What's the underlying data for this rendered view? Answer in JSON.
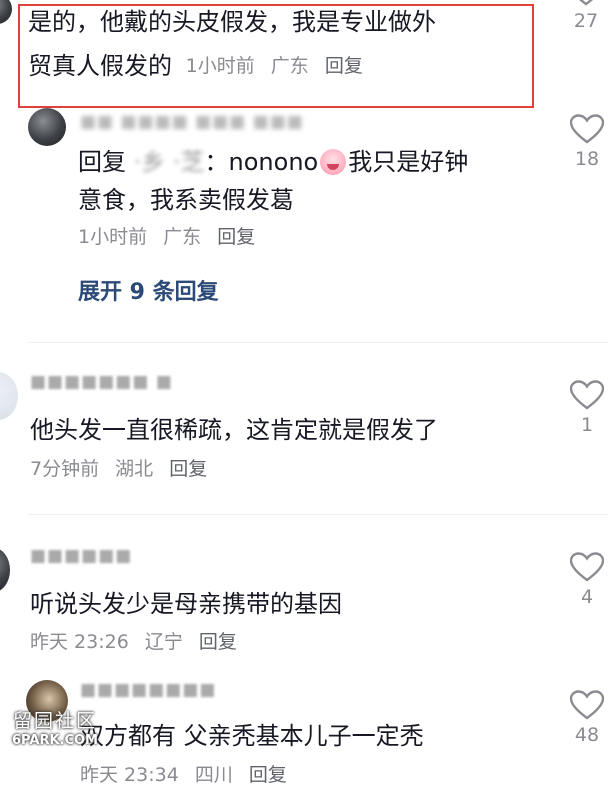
{
  "comments": [
    {
      "text_line1": "是的，他戴的头皮假发，我是专业做外",
      "text_line2": "贸真人假发的",
      "time": "1小时前",
      "location": "广东",
      "reply": "回复",
      "likes": "27"
    },
    {
      "prefix": "回复",
      "mention_suffix": "：nonono",
      "text_after_emoji": "我只是好钟",
      "text_line2": "意食，我系卖假发葛",
      "time": "1小时前",
      "location": "广东",
      "reply": "回复",
      "likes": "18",
      "emoji": "crying-face-emoji"
    },
    {
      "text": "他头发一直很稀疏，这肯定就是假发了",
      "time": "7分钟前",
      "location": "湖北",
      "reply": "回复",
      "likes": "1"
    },
    {
      "text": "听说头发少是母亲携带的基因",
      "time": "昨天 23:26",
      "location": "辽宁",
      "reply": "回复",
      "likes": "4"
    },
    {
      "text": "双方都有 父亲秃基本儿子一定秃",
      "time": "昨天 23:34",
      "location": "四川",
      "reply": "回复",
      "likes": "48"
    }
  ],
  "expand_replies": "展开 9 条回复",
  "watermark": {
    "cn": "留园社区",
    "en": "6PARK.COM"
  },
  "colors": {
    "highlight": "#e0403a",
    "link": "#2b4a78",
    "meta": "#8a8b91"
  }
}
